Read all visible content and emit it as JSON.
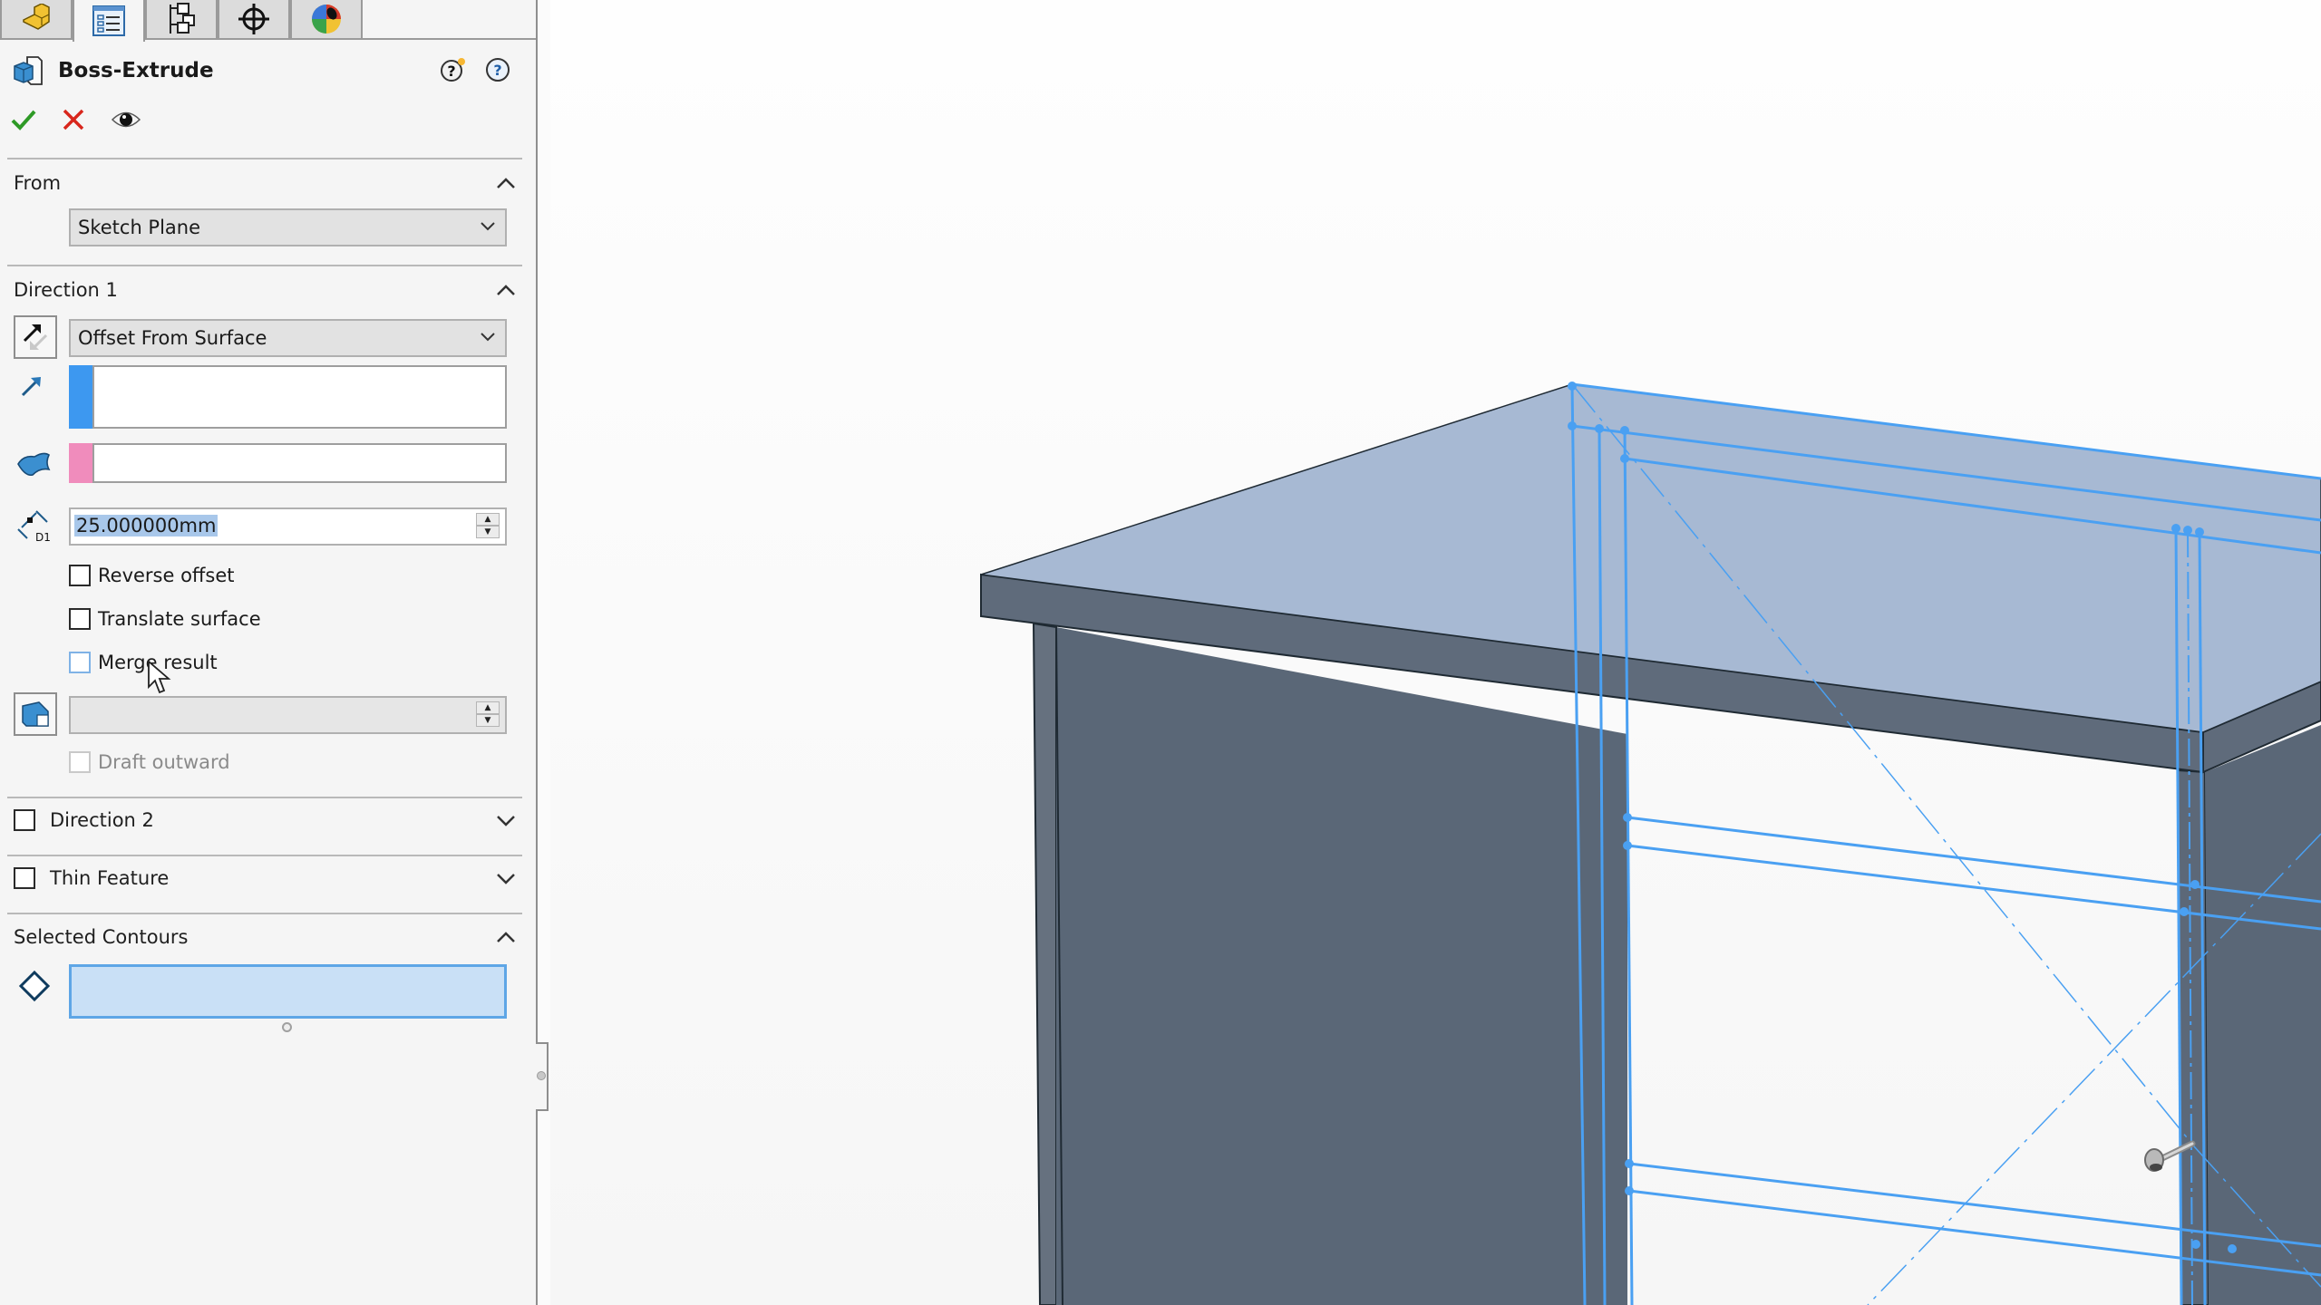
{
  "property_manager": {
    "tabs": [
      {
        "name": "feature-manager",
        "icon": "part-icon",
        "active": false
      },
      {
        "name": "property-manager",
        "icon": "property-list-icon",
        "active": true
      },
      {
        "name": "configuration-manager",
        "icon": "configuration-tree-icon",
        "active": false
      },
      {
        "name": "dimxpert-manager",
        "icon": "crosshair-icon",
        "active": false
      },
      {
        "name": "display-manager",
        "icon": "appearance-ball-icon",
        "active": false
      }
    ],
    "title": "Boss-Extrude",
    "title_icon": "boss-extrude-icon",
    "help_icons": [
      "whats-new-help-icon",
      "help-icon"
    ],
    "actions": {
      "ok": "ok-checkmark-icon",
      "cancel": "cancel-x-icon",
      "preview": "detailed-preview-eye-icon"
    },
    "from": {
      "title": "From",
      "expanded": true,
      "start_condition": "Sketch Plane"
    },
    "direction1": {
      "title": "Direction 1",
      "expanded": true,
      "end_condition": "Offset From Surface",
      "direction_field": "",
      "face_field": "",
      "offset_distance": "25.000000mm",
      "options": [
        {
          "label": "Reverse offset",
          "checked": false,
          "enabled": true
        },
        {
          "label": "Translate surface",
          "checked": false,
          "enabled": true
        },
        {
          "label": "Merge result",
          "checked": false,
          "enabled": true
        }
      ],
      "draft_angle": "",
      "draft_outward": {
        "label": "Draft outward",
        "checked": false,
        "enabled": false
      }
    },
    "direction2": {
      "title": "Direction 2",
      "checked": false,
      "expanded": false
    },
    "thin_feature": {
      "title": "Thin Feature",
      "checked": false,
      "expanded": false
    },
    "selected_contours": {
      "title": "Selected Contours",
      "expanded": true,
      "value": ""
    }
  },
  "colors": {
    "direction_swatch": "#3d98f0",
    "face_swatch": "#f08cbc",
    "sketch_lines": "#4aa0f2",
    "selection_fill": "#c9e0f6",
    "model_top": "#a7b9d3",
    "model_side": "#5b6877"
  }
}
